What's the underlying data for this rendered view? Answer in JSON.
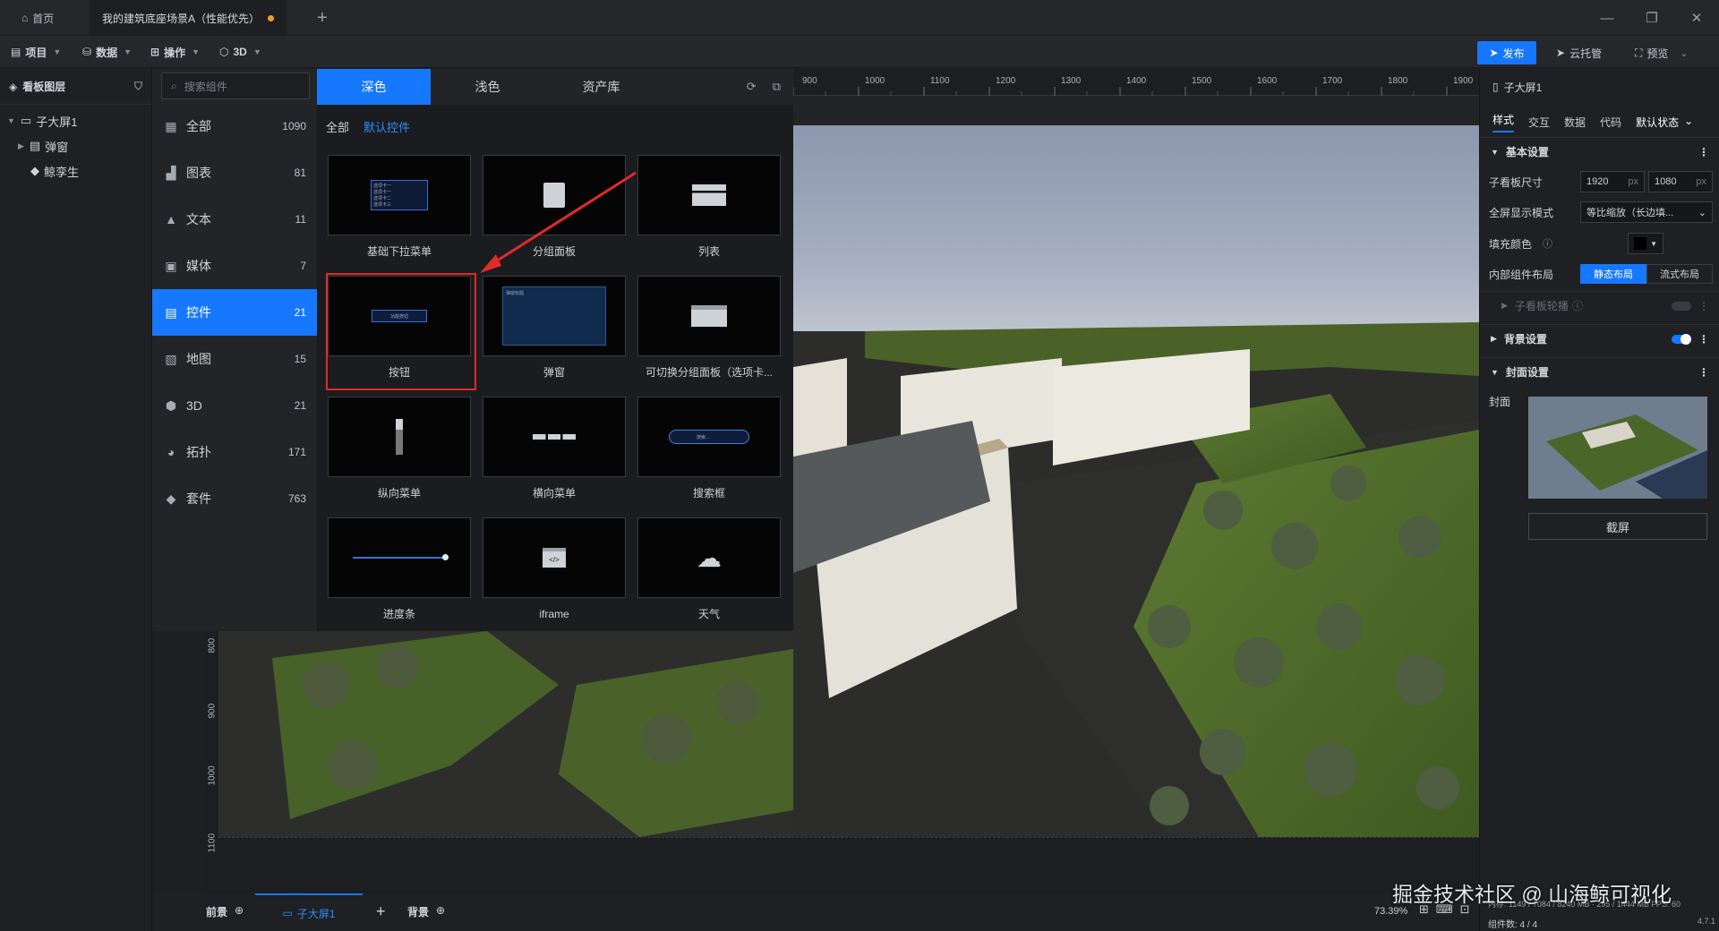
{
  "titlebar": {
    "home_label": "首页",
    "scene_tab_label": "我的建筑底座场景A（性能优先）",
    "add_tab": "+"
  },
  "toolbar": {
    "menus": [
      "项目",
      "数据",
      "操作",
      "3D"
    ],
    "publish": "发布",
    "cloud": "云托管",
    "preview": "预览"
  },
  "layers": {
    "title": "看板图层",
    "items": [
      "子大屏1",
      "弹窗",
      "鲸孪生"
    ]
  },
  "components": {
    "search_placeholder": "搜索组件",
    "categories": [
      {
        "label": "全部",
        "count": "1090"
      },
      {
        "label": "图表",
        "count": "81"
      },
      {
        "label": "文本",
        "count": "11"
      },
      {
        "label": "媒体",
        "count": "7"
      },
      {
        "label": "控件",
        "count": "21"
      },
      {
        "label": "地图",
        "count": "15"
      },
      {
        "label": "3D",
        "count": "21"
      },
      {
        "label": "拓扑",
        "count": "171"
      },
      {
        "label": "套件",
        "count": "763"
      }
    ],
    "theme_tabs": [
      "深色",
      "浅色",
      "资产库"
    ],
    "filters": [
      "全部",
      "默认控件"
    ],
    "cards": [
      "基础下拉菜单",
      "分组面板",
      "列表",
      "按钮",
      "弹窗",
      "可切换分组面板（选项卡...",
      "纵向菜单",
      "横向菜单",
      "搜索框",
      "进度条",
      "iframe",
      "天气"
    ],
    "thumb_text": {
      "dropdown": [
        "选项卡一",
        "选项卡一",
        "选项卡二",
        "选项卡三"
      ],
      "button": "功能按钮",
      "popup": "弹窗标题",
      "search": "搜索...",
      "iframe": "</>"
    }
  },
  "ruler": {
    "top": [
      "900",
      "1000",
      "1100",
      "1200",
      "1300",
      "1400",
      "1500",
      "1600",
      "1700",
      "1800",
      "1900"
    ],
    "left": [
      "800",
      "900",
      "1000",
      "1100"
    ]
  },
  "right": {
    "title": "子大屏1",
    "tabs": [
      "样式",
      "交互",
      "数据",
      "代码"
    ],
    "state_select": "默认状态",
    "basic": {
      "title": "基本设置",
      "size_label": "子看板尺寸",
      "width": "1920",
      "height": "1080",
      "unit": "px",
      "fullscreen_label": "全屏显示模式",
      "fullscreen_value": "等比缩放（长边填...",
      "fill_label": "填充颜色",
      "layout_label": "内部组件布局",
      "layout_opts": [
        "静态布局",
        "流式布局"
      ],
      "carousel_label": "子看板轮播"
    },
    "bg": {
      "title": "背景设置"
    },
    "cover": {
      "title": "封面设置",
      "cover_label": "封面",
      "screenshot": "截屏"
    }
  },
  "bottombar": {
    "foreground": "前景",
    "screen_tab": "子大屏1",
    "background": "背景",
    "zoom": "73.39%",
    "memory": "内存: 1149 / 7084 / 8240 MB · 295 / 1444 MB FPS: 60",
    "comp_count": "组件数: 4 / 4",
    "version": "4.7.1"
  },
  "watermark": "掘金技术社区 @ 山海鲸可视化",
  "colors": {
    "accent": "#1677ff",
    "highlight": "#e02b2b"
  }
}
